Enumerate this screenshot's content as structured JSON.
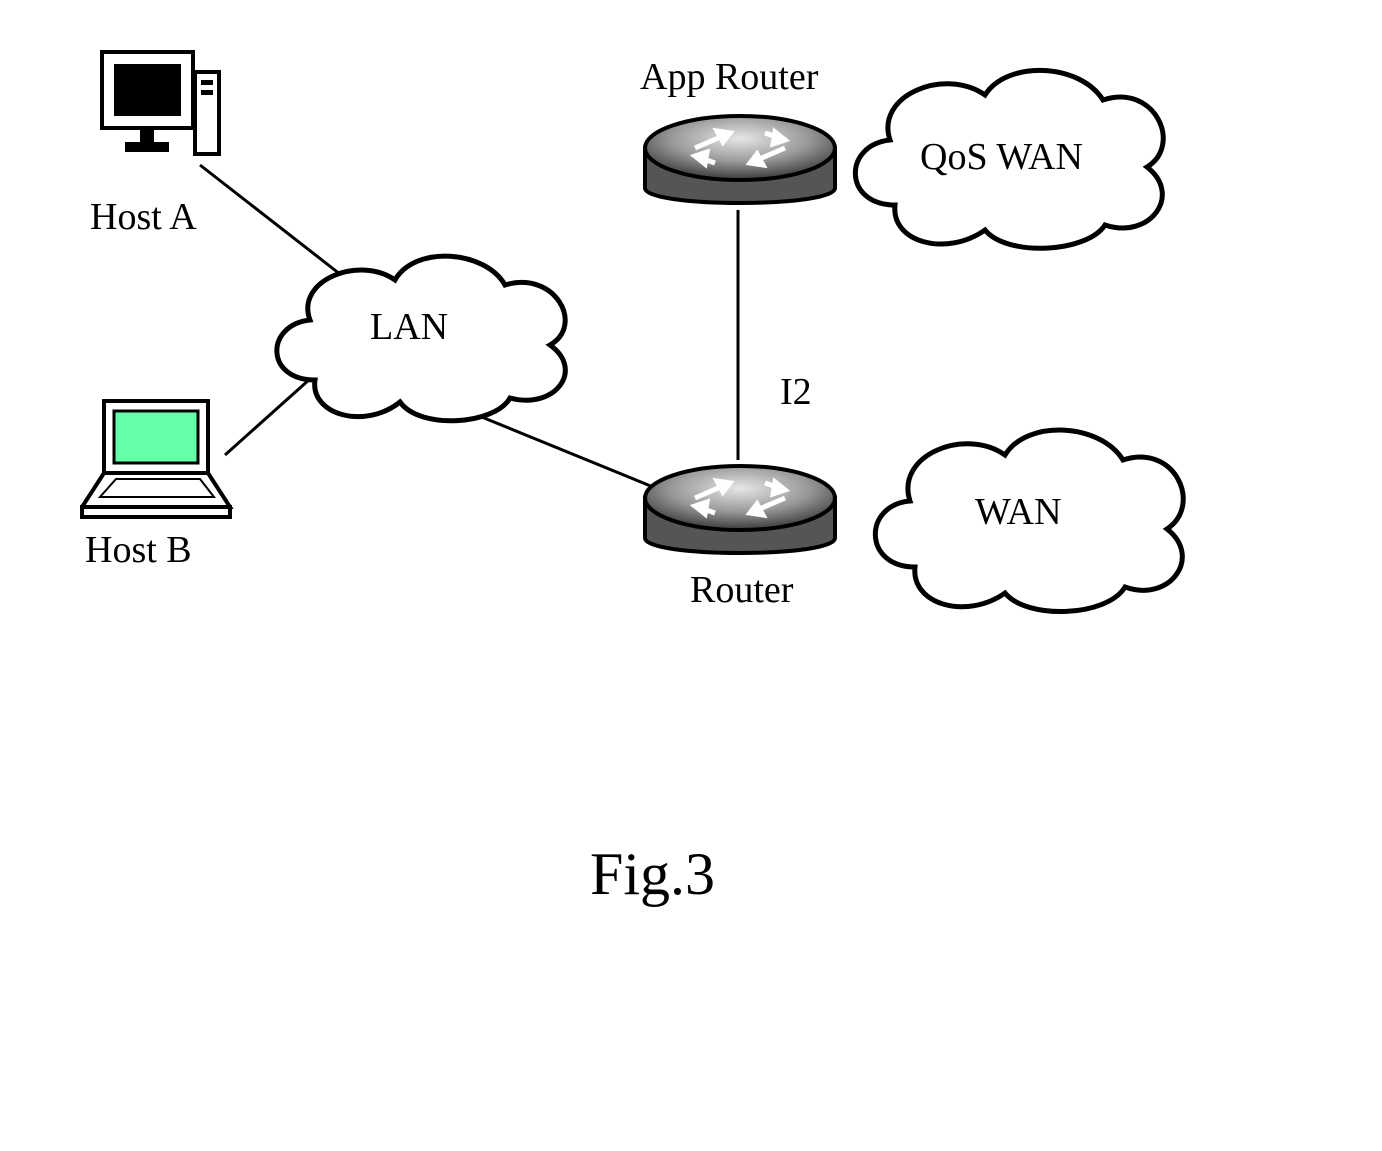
{
  "labels": {
    "host_a": "Host A",
    "host_b": "Host B",
    "lan": "LAN",
    "app_router": "App Router",
    "router": "Router",
    "qos_wan": "QoS WAN",
    "wan": "WAN",
    "link_i2": "I2"
  },
  "caption": "Fig.3"
}
